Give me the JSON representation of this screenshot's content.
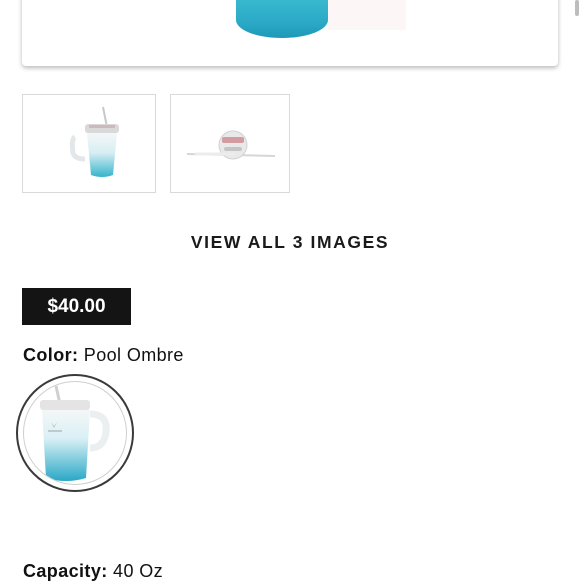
{
  "gallery": {
    "view_all_label": "VIEW ALL 3 IMAGES",
    "thumbnails": [
      {
        "name": "tumbler-thumbnail",
        "selected": false
      },
      {
        "name": "lid-thumbnail",
        "selected": false
      }
    ]
  },
  "product": {
    "price": "$40.00",
    "color_label": "Color:",
    "color_value": "Pool Ombre",
    "capacity_label": "Capacity:",
    "capacity_value": "40 Oz",
    "swatches": [
      {
        "name": "Pool Ombre",
        "selected": true
      }
    ]
  },
  "colors": {
    "accent_teal": "#2aa8c6",
    "badge_bg": "#141414",
    "badge_text": "#ffffff"
  },
  "icons": [
    "tumbler-image",
    "lid-image",
    "scrollbar"
  ]
}
